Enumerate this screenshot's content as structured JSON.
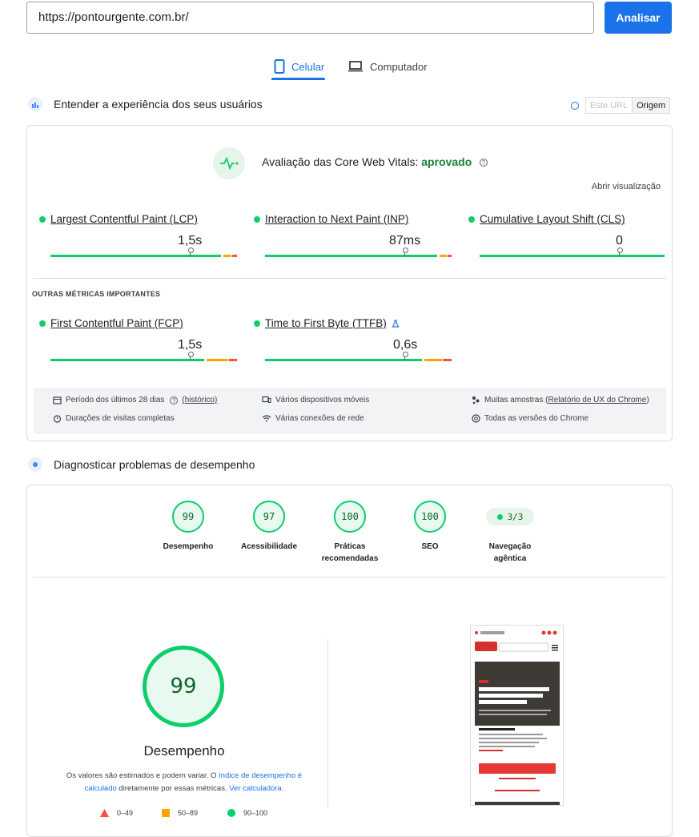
{
  "url_bar": {
    "value": "https://pontourgente.com.br/",
    "button": "Analisar"
  },
  "device_tabs": [
    {
      "label": "Celular"
    },
    {
      "label": "Computador"
    }
  ],
  "field": {
    "heading": "Entender a experiência dos seus usuários",
    "toggle": {
      "this_url": "Este URL",
      "origin": "Origem"
    },
    "cwv_title": "Avaliação das Core Web Vitals:",
    "cwv_status": "aprovado",
    "expand": "Abrir visualização",
    "core_metrics": [
      {
        "name": "Largest Contentful Paint (LCP)",
        "value": "1,5s"
      },
      {
        "name": "Interaction to Next Paint (INP)",
        "value": "87ms"
      },
      {
        "name": "Cumulative Layout Shift (CLS)",
        "value": "0"
      }
    ],
    "other_label": "OUTRAS MÉTRICAS IMPORTANTES",
    "other_metrics": [
      {
        "name": "First Contentful Paint (FCP)",
        "value": "1,5s"
      },
      {
        "name": "Time to First Byte (TTFB)",
        "value": "0,6s"
      }
    ],
    "info": {
      "period": "Período dos últimos 28 dias",
      "history": "(histórico)",
      "devices": "Vários dispositivos móveis",
      "samples_prefix": "Muitas amostras (",
      "samples_link": "Relatório de UX do Chrome",
      "samples_suffix": ")",
      "durations": "Durações de visitas completas",
      "connections": "Várias conexões de rede",
      "versions": "Todas as versões do Chrome"
    }
  },
  "lab": {
    "heading": "Diagnosticar problemas de desempenho",
    "scores": [
      {
        "value": "99",
        "label": "Desempenho"
      },
      {
        "value": "97",
        "label": "Acessibilidade"
      },
      {
        "value": "100",
        "label": "Práticas recomendadas"
      },
      {
        "value": "100",
        "label": "SEO"
      }
    ],
    "agentic": {
      "value": "3/3",
      "label": "Navegação agêntica"
    },
    "performance_score": "99",
    "performance_label": "Desempenho",
    "note_1": "Os valores são estimados e podem variar. O ",
    "note_link_1": "índice de desempenho é calculado",
    "note_2": " diretamente por essas métricas. ",
    "note_link_2": "Ver calculadora.",
    "legend": [
      {
        "label": "0–49"
      },
      {
        "label": "50–89"
      },
      {
        "label": "90–100"
      }
    ]
  },
  "colors": {
    "accent": "#1a73e8",
    "pass": "#0cce6b",
    "average": "#ffa400",
    "fail": "#ff4e42"
  }
}
